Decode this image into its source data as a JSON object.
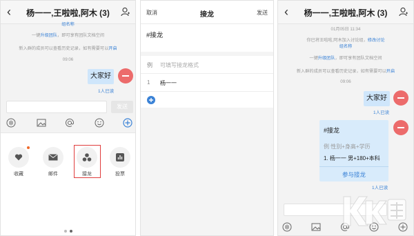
{
  "panel1": {
    "title": "杨一一,王啦啦,阿木 (3)",
    "group_name": "组名称",
    "upgrade_notice": {
      "pre": "一键",
      "link": "升级团队",
      "post": "，即可享有团队文档空间"
    },
    "history_notice": {
      "text": "新入群的成员可以查看历史记录，如有需要可以",
      "link": "开启"
    },
    "time": "09:06",
    "message": "大家好",
    "read_count": "1人已读",
    "send_label": "发送",
    "tray": [
      {
        "label": "收藏",
        "icon": "heart-icon"
      },
      {
        "label": "邮件",
        "icon": "mail-icon"
      },
      {
        "label": "接龙",
        "icon": "relay-icon"
      },
      {
        "label": "投票",
        "icon": "vote-icon"
      }
    ]
  },
  "panel2": {
    "cancel": "取消",
    "title": "接龙",
    "send": "发送",
    "hashtag": "#接龙",
    "example_mark": "例",
    "example_placeholder": "可填写接龙格式",
    "row_number": "1",
    "row_value": "杨一一"
  },
  "panel3": {
    "title": "杨一一,王啦啦,阿木 (3)",
    "timestamp": "01月05日 11:34",
    "invite_notice": {
      "text": "你已将王啦啦,阿木加入讨论组，",
      "link": "修改讨论"
    },
    "group_name": "组名称",
    "upgrade_notice": {
      "pre": "一键",
      "link": "升级团队",
      "post": "，即可享有团队文档空间"
    },
    "history_notice": {
      "text": "新入群的成员可以查看历史记录，如有需要可以",
      "link": "开启"
    },
    "time": "09:06",
    "message": "大家好",
    "read_count": "1人已读",
    "card": {
      "hashtag": "#接龙",
      "example": "例 性别+身高+学历",
      "entry": "1. 杨一一 男+180+本科",
      "button": "参与接龙"
    },
    "card_read_count": "1人已读"
  },
  "colors": {
    "accent_blue": "#3a82d6",
    "bubble": "#cfe6fb",
    "avatar": "#ec6b6b",
    "highlight_border": "#e03c3c"
  }
}
